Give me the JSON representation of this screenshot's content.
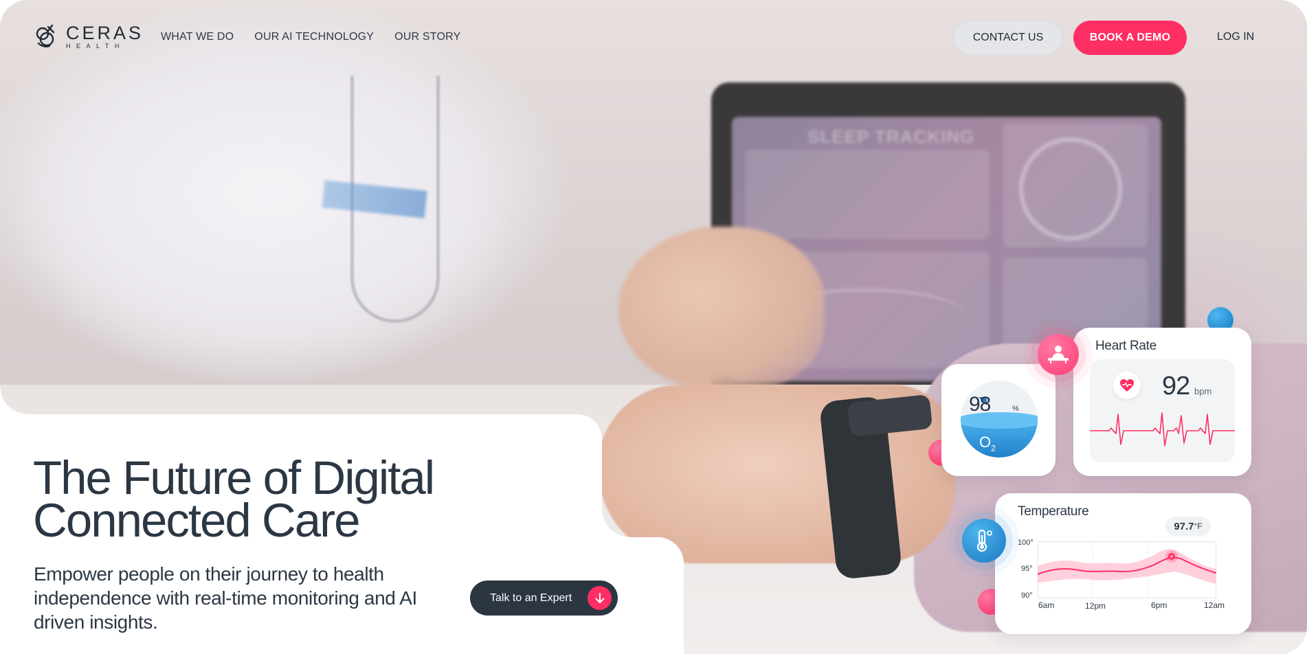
{
  "brand": {
    "name": "CERAS",
    "sub": "HEALTH"
  },
  "nav": {
    "items": [
      {
        "label": "WHAT WE DO"
      },
      {
        "label": "OUR AI TECHNOLOGY"
      },
      {
        "label": "OUR STORY"
      }
    ],
    "contact_label": "CONTACT US",
    "demo_label": "BOOK A DEMO",
    "login_label": "LOG IN"
  },
  "hero": {
    "headline_line1": "The Future of Digital",
    "headline_line2": "Connected Care",
    "subline": "Empower people on their journey to health independence with real-time monitoring and AI driven insights.",
    "cta_label": "Talk to an Expert"
  },
  "monitor_screen": {
    "title": "SLEEP TRACKING"
  },
  "oxygen_card": {
    "value": "98",
    "unit": "%",
    "label": "O",
    "label_sub": "2"
  },
  "heart_card": {
    "title": "Heart Rate",
    "value": "92",
    "unit": "bpm"
  },
  "temperature_card": {
    "title": "Temperature",
    "badge_value": "97.7",
    "badge_unit": "°F",
    "y_labels": [
      "100°",
      "95°",
      "90°"
    ],
    "x_labels": [
      "6am",
      "12pm",
      "6pm",
      "12am"
    ]
  },
  "colors": {
    "accent": "#ff2e63",
    "dark": "#2b3642",
    "blue": "#1f7fc7",
    "text": "#2c3744"
  },
  "icons": [
    "logo-icon",
    "person-icon",
    "thermometer-icon",
    "heart-icon",
    "arrow-down-icon"
  ]
}
